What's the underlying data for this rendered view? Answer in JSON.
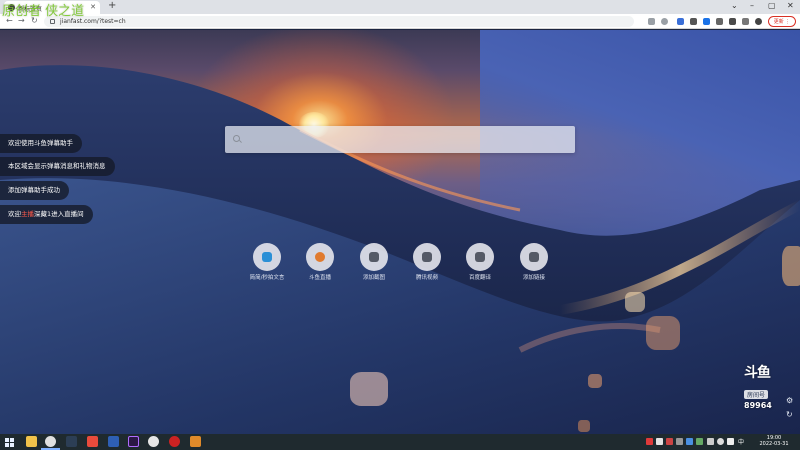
{
  "browser": {
    "tab_title": "新标签页",
    "url": "jianfast.com/?test=ch",
    "update_label": "更新 ⋮"
  },
  "search": {
    "placeholder": ""
  },
  "shortcuts": [
    {
      "label": "简简/秒拍文言",
      "icon": "la-icon",
      "color": "#2a8fd6"
    },
    {
      "label": "斗鱼直播",
      "icon": "douyu-icon",
      "color": "#e07a2e"
    },
    {
      "label": "添加截图",
      "icon": "link-icon",
      "color": "#555a66"
    },
    {
      "label": "腾讯视频",
      "icon": "link-icon",
      "color": "#555a66"
    },
    {
      "label": "百度翻译",
      "icon": "link-icon",
      "color": "#555a66"
    },
    {
      "label": "添加链接",
      "icon": "link-icon",
      "color": "#555a66"
    }
  ],
  "chat_messages": [
    {
      "text": "欢迎使用斗鱼弹幕助手"
    },
    {
      "text": "本区域会显示弹幕消息和礼物消息"
    },
    {
      "text": "添加弹幕助手成功"
    },
    {
      "prefix": "欢迎",
      "highlight": "主播",
      "suffix": "深藏1进入直播间"
    }
  ],
  "watermark": {
    "text": "原创者 侠之道"
  },
  "room_logo": {
    "brand": "斗鱼",
    "badge": "房间号",
    "room_number": "89964"
  },
  "taskbar": {
    "time": "19:00",
    "date": "2022-03-31",
    "ime": "中"
  }
}
